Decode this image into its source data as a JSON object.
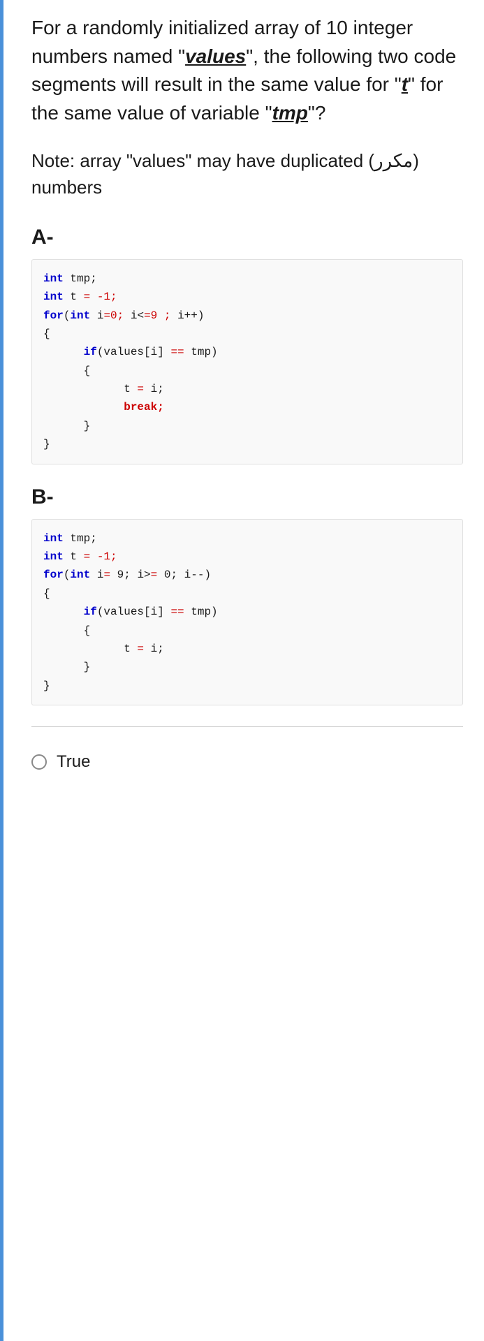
{
  "page": {
    "border_color": "#4a90d9",
    "question": {
      "line1": "For a randomly",
      "line2": "initialized array of 10",
      "line3": "integer numbers named",
      "values_word": "values",
      "line4_pre": "\"",
      "line4_post": "\", the following",
      "line5": "two code segments will",
      "line6": "result in the same value",
      "line7_pre": "for \"",
      "t_word": "t",
      "line7_post": "\" for the same value",
      "line8_pre": "of variable \"",
      "tmp_word": "tmp",
      "line8_post": "\"?"
    },
    "note": {
      "text1": "Note: array \"values\" may",
      "text2": "have duplicated (مكرر)",
      "text3": "numbers"
    },
    "section_a": {
      "label": "A-",
      "code_lines": [
        {
          "type": "code",
          "content": "int tmp;"
        },
        {
          "type": "code",
          "content": "int t = -1;"
        },
        {
          "type": "code",
          "content": "for(int i=0; i<=9 ; i++)"
        },
        {
          "type": "code",
          "content": "{"
        },
        {
          "type": "code",
          "content": "        if(values[i] == tmp)"
        },
        {
          "type": "code",
          "content": "        {"
        },
        {
          "type": "code",
          "content": "                t = i;"
        },
        {
          "type": "code",
          "content": "                break;"
        },
        {
          "type": "code",
          "content": "        }"
        },
        {
          "type": "code",
          "content": "}"
        }
      ]
    },
    "section_b": {
      "label": "B-",
      "code_lines": [
        {
          "type": "code",
          "content": "int tmp;"
        },
        {
          "type": "code",
          "content": "int t = -1;"
        },
        {
          "type": "code",
          "content": "for(int i= 9; i>= 0; i--)"
        },
        {
          "type": "code",
          "content": "{"
        },
        {
          "type": "code",
          "content": "        if(values[i] == tmp)"
        },
        {
          "type": "code",
          "content": "        {"
        },
        {
          "type": "code",
          "content": "                t = i;"
        },
        {
          "type": "code",
          "content": "        }"
        },
        {
          "type": "code",
          "content": "}"
        }
      ]
    },
    "answers": [
      {
        "id": "true",
        "label": "True",
        "selected": false
      }
    ]
  }
}
